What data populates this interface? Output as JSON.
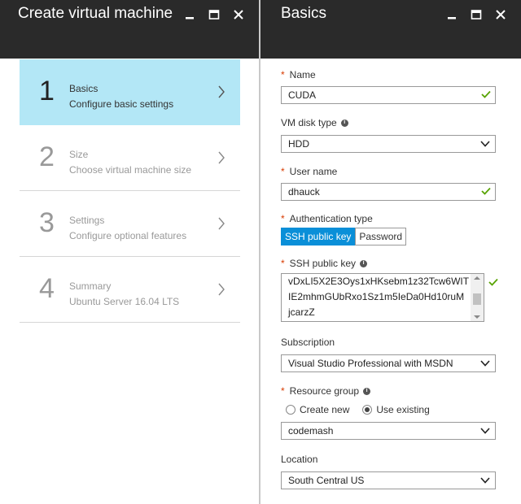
{
  "left_blade": {
    "title": "Create virtual machine",
    "steps": [
      {
        "number": "1",
        "title": "Basics",
        "subtitle": "Configure basic settings",
        "active": true
      },
      {
        "number": "2",
        "title": "Size",
        "subtitle": "Choose virtual machine size",
        "active": false
      },
      {
        "number": "3",
        "title": "Settings",
        "subtitle": "Configure optional features",
        "active": false
      },
      {
        "number": "4",
        "title": "Summary",
        "subtitle": "Ubuntu Server 16.04 LTS",
        "active": false
      }
    ]
  },
  "right_blade": {
    "title": "Basics",
    "name": {
      "label": "Name",
      "value": "CUDA"
    },
    "vm_disk_type": {
      "label": "VM disk type",
      "value": "HDD"
    },
    "user_name": {
      "label": "User name",
      "value": "dhauck"
    },
    "authentication_type": {
      "label": "Authentication type",
      "options": [
        "SSH public key",
        "Password"
      ],
      "selected": "SSH public key"
    },
    "ssh_public_key": {
      "label": "SSH public key",
      "lines": [
        "vDxLI5X2E3Oys1xHKsebm1z32Tcw6WIT",
        "IE2mhmGUbRxo1Sz1m5IeDa0Hd10ruM",
        "jcarzZ"
      ]
    },
    "subscription": {
      "label": "Subscription",
      "value": "Visual Studio Professional with MSDN"
    },
    "resource_group": {
      "label": "Resource group",
      "options": [
        "Create new",
        "Use existing"
      ],
      "selected": "Use existing",
      "value": "codemash"
    },
    "location": {
      "label": "Location",
      "value": "South Central US"
    }
  },
  "icons": [
    "minimize-icon",
    "maximize-icon",
    "close-icon",
    "chevron-right-icon",
    "chevron-down-icon",
    "check-icon",
    "info-icon"
  ],
  "colors": {
    "header_bg": "#2a2a2a",
    "active_step_bg": "#b3e7f6",
    "toggle_selected_bg": "#0a8fd8",
    "valid_check": "#57a300",
    "required_asterisk": "#d83b01"
  }
}
